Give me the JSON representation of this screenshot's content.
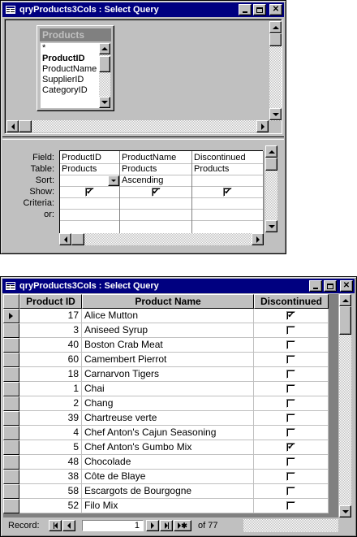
{
  "query_window": {
    "title": "qryProducts3Cols : Select Query",
    "field_list": {
      "title": "Products",
      "items": [
        "*",
        "ProductID",
        "ProductName",
        "SupplierID",
        "CategoryID"
      ]
    },
    "grid": {
      "row_labels": [
        "Field:",
        "Table:",
        "Sort:",
        "Show:",
        "Criteria:",
        "or:"
      ],
      "columns": [
        {
          "field": "ProductID",
          "table": "Products",
          "sort": "",
          "show": true
        },
        {
          "field": "ProductName",
          "table": "Products",
          "sort": "Ascending",
          "show": true
        },
        {
          "field": "Discontinued",
          "table": "Products",
          "sort": "",
          "show": true
        }
      ]
    }
  },
  "datasheet_window": {
    "title": "qryProducts3Cols : Select Query",
    "headers": [
      "Product ID",
      "Product Name",
      "Discontinued"
    ],
    "rows": [
      {
        "id": "17",
        "name": "Alice Mutton",
        "discontinued": true
      },
      {
        "id": "3",
        "name": "Aniseed Syrup",
        "discontinued": false
      },
      {
        "id": "40",
        "name": "Boston Crab Meat",
        "discontinued": false
      },
      {
        "id": "60",
        "name": "Camembert Pierrot",
        "discontinued": false
      },
      {
        "id": "18",
        "name": "Carnarvon Tigers",
        "discontinued": false
      },
      {
        "id": "1",
        "name": "Chai",
        "discontinued": false
      },
      {
        "id": "2",
        "name": "Chang",
        "discontinued": false
      },
      {
        "id": "39",
        "name": "Chartreuse verte",
        "discontinued": false
      },
      {
        "id": "4",
        "name": "Chef Anton's Cajun Seasoning",
        "discontinued": false
      },
      {
        "id": "5",
        "name": "Chef Anton's Gumbo Mix",
        "discontinued": true
      },
      {
        "id": "48",
        "name": "Chocolade",
        "discontinued": false
      },
      {
        "id": "38",
        "name": "Côte de Blaye",
        "discontinued": false
      },
      {
        "id": "58",
        "name": "Escargots de Bourgogne",
        "discontinued": false
      },
      {
        "id": "52",
        "name": "Filo Mix",
        "discontinued": false
      }
    ],
    "nav": {
      "label": "Record:",
      "current": "1",
      "of_text": "of 77"
    }
  },
  "colors": {
    "title_bar": "#000080",
    "window_face": "#c0c0c0",
    "grid_bg": "#ffffff"
  }
}
